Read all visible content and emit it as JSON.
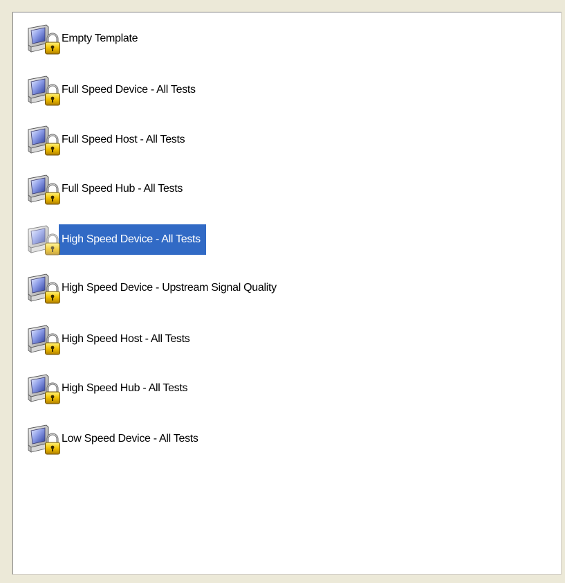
{
  "list": {
    "selected_index": 4,
    "items": [
      {
        "label": "Empty Template",
        "icon": "locked-monitor-icon"
      },
      {
        "label": "Full Speed Device - All Tests",
        "icon": "locked-monitor-icon"
      },
      {
        "label": "Full Speed Host - All Tests",
        "icon": "locked-monitor-icon"
      },
      {
        "label": "Full Speed Hub - All Tests",
        "icon": "locked-monitor-icon"
      },
      {
        "label": "High Speed Device - All Tests",
        "icon": "locked-monitor-icon"
      },
      {
        "label": "High Speed Device - Upstream Signal Quality",
        "icon": "locked-monitor-icon"
      },
      {
        "label": "High Speed Host - All Tests",
        "icon": "locked-monitor-icon"
      },
      {
        "label": "High Speed Hub - All Tests",
        "icon": "locked-monitor-icon"
      },
      {
        "label": "Low Speed Device - All Tests",
        "icon": "locked-monitor-icon"
      }
    ]
  },
  "colors": {
    "selection": "#316ac5",
    "window_bg": "#ece9d8",
    "list_bg": "#ffffff"
  }
}
